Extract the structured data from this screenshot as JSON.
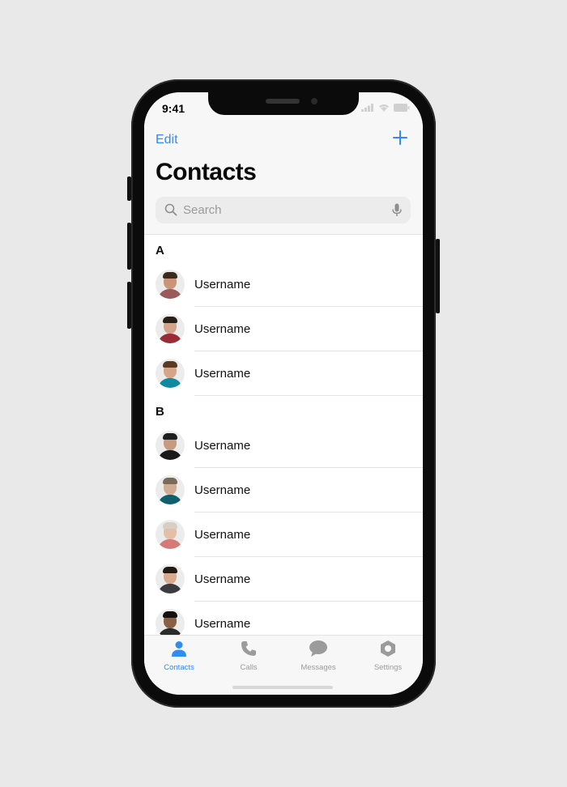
{
  "status": {
    "time": "9:41"
  },
  "nav": {
    "edit_label": "Edit",
    "add_icon": "plus-icon"
  },
  "page": {
    "title": "Contacts"
  },
  "search": {
    "placeholder": "Search",
    "left_icon": "search-icon",
    "right_icon": "microphone-icon"
  },
  "sections": [
    {
      "letter": "A",
      "contacts": [
        {
          "name": "Username",
          "shirt": "#9a5a5a",
          "skin": "#c99479",
          "hair": "#3a2a20"
        },
        {
          "name": "Username",
          "shirt": "#9b2b36",
          "skin": "#d2a58b",
          "hair": "#2a1f18"
        },
        {
          "name": "Username",
          "shirt": "#0f8aa0",
          "skin": "#d6a587",
          "hair": "#5a3a22"
        }
      ]
    },
    {
      "letter": "B",
      "contacts": [
        {
          "name": "Username",
          "shirt": "#1a1a1a",
          "skin": "#c79b82",
          "hair": "#1f1f1f"
        },
        {
          "name": "Username",
          "shirt": "#0f5f6e",
          "skin": "#d2ad95",
          "hair": "#7a6a5a"
        },
        {
          "name": "Username",
          "shirt": "#d67a78",
          "skin": "#e3bfa8",
          "hair": "#d8cfc4"
        },
        {
          "name": "Username",
          "shirt": "#3b3b40",
          "skin": "#d8ab8f",
          "hair": "#241a14"
        },
        {
          "name": "Username",
          "shirt": "#2b2b2b",
          "skin": "#8a5f44",
          "hair": "#141010"
        }
      ]
    }
  ],
  "tabs": [
    {
      "label": "Contacts",
      "icon": "person-icon",
      "active": true
    },
    {
      "label": "Calls",
      "icon": "phone-icon",
      "active": false
    },
    {
      "label": "Messages",
      "icon": "chat-bubble-icon",
      "active": false
    },
    {
      "label": "Settings",
      "icon": "gear-hexagon-icon",
      "active": false
    }
  ],
  "colors": {
    "accent": "#2f8cf0",
    "inactive": "#9b9b9b",
    "bar": "#f7f7f7"
  }
}
